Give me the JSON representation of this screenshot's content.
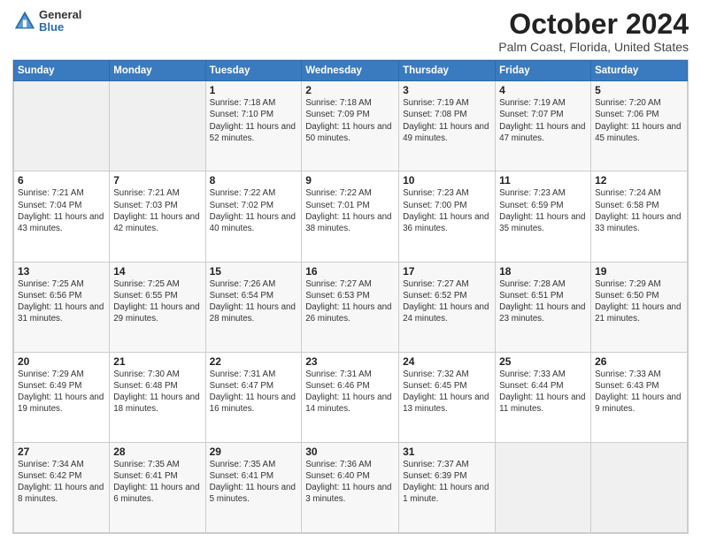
{
  "header": {
    "logo": {
      "general": "General",
      "blue": "Blue"
    },
    "title": "October 2024",
    "subtitle": "Palm Coast, Florida, United States"
  },
  "calendar": {
    "days_of_week": [
      "Sunday",
      "Monday",
      "Tuesday",
      "Wednesday",
      "Thursday",
      "Friday",
      "Saturday"
    ],
    "weeks": [
      [
        {
          "day": "",
          "info": ""
        },
        {
          "day": "",
          "info": ""
        },
        {
          "day": "1",
          "info": "Sunrise: 7:18 AM\nSunset: 7:10 PM\nDaylight: 11 hours and 52 minutes."
        },
        {
          "day": "2",
          "info": "Sunrise: 7:18 AM\nSunset: 7:09 PM\nDaylight: 11 hours and 50 minutes."
        },
        {
          "day": "3",
          "info": "Sunrise: 7:19 AM\nSunset: 7:08 PM\nDaylight: 11 hours and 49 minutes."
        },
        {
          "day": "4",
          "info": "Sunrise: 7:19 AM\nSunset: 7:07 PM\nDaylight: 11 hours and 47 minutes."
        },
        {
          "day": "5",
          "info": "Sunrise: 7:20 AM\nSunset: 7:06 PM\nDaylight: 11 hours and 45 minutes."
        }
      ],
      [
        {
          "day": "6",
          "info": "Sunrise: 7:21 AM\nSunset: 7:04 PM\nDaylight: 11 hours and 43 minutes."
        },
        {
          "day": "7",
          "info": "Sunrise: 7:21 AM\nSunset: 7:03 PM\nDaylight: 11 hours and 42 minutes."
        },
        {
          "day": "8",
          "info": "Sunrise: 7:22 AM\nSunset: 7:02 PM\nDaylight: 11 hours and 40 minutes."
        },
        {
          "day": "9",
          "info": "Sunrise: 7:22 AM\nSunset: 7:01 PM\nDaylight: 11 hours and 38 minutes."
        },
        {
          "day": "10",
          "info": "Sunrise: 7:23 AM\nSunset: 7:00 PM\nDaylight: 11 hours and 36 minutes."
        },
        {
          "day": "11",
          "info": "Sunrise: 7:23 AM\nSunset: 6:59 PM\nDaylight: 11 hours and 35 minutes."
        },
        {
          "day": "12",
          "info": "Sunrise: 7:24 AM\nSunset: 6:58 PM\nDaylight: 11 hours and 33 minutes."
        }
      ],
      [
        {
          "day": "13",
          "info": "Sunrise: 7:25 AM\nSunset: 6:56 PM\nDaylight: 11 hours and 31 minutes."
        },
        {
          "day": "14",
          "info": "Sunrise: 7:25 AM\nSunset: 6:55 PM\nDaylight: 11 hours and 29 minutes."
        },
        {
          "day": "15",
          "info": "Sunrise: 7:26 AM\nSunset: 6:54 PM\nDaylight: 11 hours and 28 minutes."
        },
        {
          "day": "16",
          "info": "Sunrise: 7:27 AM\nSunset: 6:53 PM\nDaylight: 11 hours and 26 minutes."
        },
        {
          "day": "17",
          "info": "Sunrise: 7:27 AM\nSunset: 6:52 PM\nDaylight: 11 hours and 24 minutes."
        },
        {
          "day": "18",
          "info": "Sunrise: 7:28 AM\nSunset: 6:51 PM\nDaylight: 11 hours and 23 minutes."
        },
        {
          "day": "19",
          "info": "Sunrise: 7:29 AM\nSunset: 6:50 PM\nDaylight: 11 hours and 21 minutes."
        }
      ],
      [
        {
          "day": "20",
          "info": "Sunrise: 7:29 AM\nSunset: 6:49 PM\nDaylight: 11 hours and 19 minutes."
        },
        {
          "day": "21",
          "info": "Sunrise: 7:30 AM\nSunset: 6:48 PM\nDaylight: 11 hours and 18 minutes."
        },
        {
          "day": "22",
          "info": "Sunrise: 7:31 AM\nSunset: 6:47 PM\nDaylight: 11 hours and 16 minutes."
        },
        {
          "day": "23",
          "info": "Sunrise: 7:31 AM\nSunset: 6:46 PM\nDaylight: 11 hours and 14 minutes."
        },
        {
          "day": "24",
          "info": "Sunrise: 7:32 AM\nSunset: 6:45 PM\nDaylight: 11 hours and 13 minutes."
        },
        {
          "day": "25",
          "info": "Sunrise: 7:33 AM\nSunset: 6:44 PM\nDaylight: 11 hours and 11 minutes."
        },
        {
          "day": "26",
          "info": "Sunrise: 7:33 AM\nSunset: 6:43 PM\nDaylight: 11 hours and 9 minutes."
        }
      ],
      [
        {
          "day": "27",
          "info": "Sunrise: 7:34 AM\nSunset: 6:42 PM\nDaylight: 11 hours and 8 minutes."
        },
        {
          "day": "28",
          "info": "Sunrise: 7:35 AM\nSunset: 6:41 PM\nDaylight: 11 hours and 6 minutes."
        },
        {
          "day": "29",
          "info": "Sunrise: 7:35 AM\nSunset: 6:41 PM\nDaylight: 11 hours and 5 minutes."
        },
        {
          "day": "30",
          "info": "Sunrise: 7:36 AM\nSunset: 6:40 PM\nDaylight: 11 hours and 3 minutes."
        },
        {
          "day": "31",
          "info": "Sunrise: 7:37 AM\nSunset: 6:39 PM\nDaylight: 11 hours and 1 minute."
        },
        {
          "day": "",
          "info": ""
        },
        {
          "day": "",
          "info": ""
        }
      ]
    ]
  }
}
